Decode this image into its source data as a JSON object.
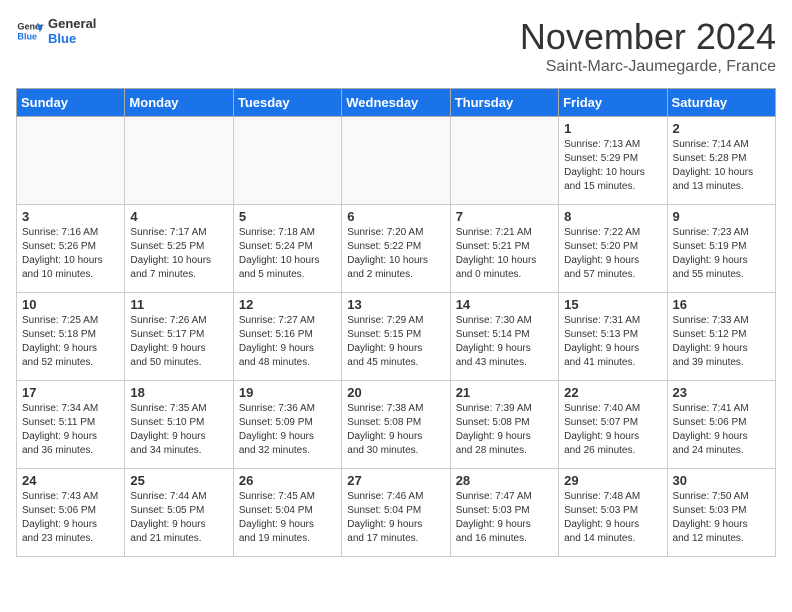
{
  "logo": {
    "line1": "General",
    "line2": "Blue"
  },
  "title": "November 2024",
  "location": "Saint-Marc-Jaumegarde, France",
  "days_of_week": [
    "Sunday",
    "Monday",
    "Tuesday",
    "Wednesday",
    "Thursday",
    "Friday",
    "Saturday"
  ],
  "weeks": [
    [
      {
        "day": "",
        "detail": ""
      },
      {
        "day": "",
        "detail": ""
      },
      {
        "day": "",
        "detail": ""
      },
      {
        "day": "",
        "detail": ""
      },
      {
        "day": "",
        "detail": ""
      },
      {
        "day": "1",
        "detail": "Sunrise: 7:13 AM\nSunset: 5:29 PM\nDaylight: 10 hours\nand 15 minutes."
      },
      {
        "day": "2",
        "detail": "Sunrise: 7:14 AM\nSunset: 5:28 PM\nDaylight: 10 hours\nand 13 minutes."
      }
    ],
    [
      {
        "day": "3",
        "detail": "Sunrise: 7:16 AM\nSunset: 5:26 PM\nDaylight: 10 hours\nand 10 minutes."
      },
      {
        "day": "4",
        "detail": "Sunrise: 7:17 AM\nSunset: 5:25 PM\nDaylight: 10 hours\nand 7 minutes."
      },
      {
        "day": "5",
        "detail": "Sunrise: 7:18 AM\nSunset: 5:24 PM\nDaylight: 10 hours\nand 5 minutes."
      },
      {
        "day": "6",
        "detail": "Sunrise: 7:20 AM\nSunset: 5:22 PM\nDaylight: 10 hours\nand 2 minutes."
      },
      {
        "day": "7",
        "detail": "Sunrise: 7:21 AM\nSunset: 5:21 PM\nDaylight: 10 hours\nand 0 minutes."
      },
      {
        "day": "8",
        "detail": "Sunrise: 7:22 AM\nSunset: 5:20 PM\nDaylight: 9 hours\nand 57 minutes."
      },
      {
        "day": "9",
        "detail": "Sunrise: 7:23 AM\nSunset: 5:19 PM\nDaylight: 9 hours\nand 55 minutes."
      }
    ],
    [
      {
        "day": "10",
        "detail": "Sunrise: 7:25 AM\nSunset: 5:18 PM\nDaylight: 9 hours\nand 52 minutes."
      },
      {
        "day": "11",
        "detail": "Sunrise: 7:26 AM\nSunset: 5:17 PM\nDaylight: 9 hours\nand 50 minutes."
      },
      {
        "day": "12",
        "detail": "Sunrise: 7:27 AM\nSunset: 5:16 PM\nDaylight: 9 hours\nand 48 minutes."
      },
      {
        "day": "13",
        "detail": "Sunrise: 7:29 AM\nSunset: 5:15 PM\nDaylight: 9 hours\nand 45 minutes."
      },
      {
        "day": "14",
        "detail": "Sunrise: 7:30 AM\nSunset: 5:14 PM\nDaylight: 9 hours\nand 43 minutes."
      },
      {
        "day": "15",
        "detail": "Sunrise: 7:31 AM\nSunset: 5:13 PM\nDaylight: 9 hours\nand 41 minutes."
      },
      {
        "day": "16",
        "detail": "Sunrise: 7:33 AM\nSunset: 5:12 PM\nDaylight: 9 hours\nand 39 minutes."
      }
    ],
    [
      {
        "day": "17",
        "detail": "Sunrise: 7:34 AM\nSunset: 5:11 PM\nDaylight: 9 hours\nand 36 minutes."
      },
      {
        "day": "18",
        "detail": "Sunrise: 7:35 AM\nSunset: 5:10 PM\nDaylight: 9 hours\nand 34 minutes."
      },
      {
        "day": "19",
        "detail": "Sunrise: 7:36 AM\nSunset: 5:09 PM\nDaylight: 9 hours\nand 32 minutes."
      },
      {
        "day": "20",
        "detail": "Sunrise: 7:38 AM\nSunset: 5:08 PM\nDaylight: 9 hours\nand 30 minutes."
      },
      {
        "day": "21",
        "detail": "Sunrise: 7:39 AM\nSunset: 5:08 PM\nDaylight: 9 hours\nand 28 minutes."
      },
      {
        "day": "22",
        "detail": "Sunrise: 7:40 AM\nSunset: 5:07 PM\nDaylight: 9 hours\nand 26 minutes."
      },
      {
        "day": "23",
        "detail": "Sunrise: 7:41 AM\nSunset: 5:06 PM\nDaylight: 9 hours\nand 24 minutes."
      }
    ],
    [
      {
        "day": "24",
        "detail": "Sunrise: 7:43 AM\nSunset: 5:06 PM\nDaylight: 9 hours\nand 23 minutes."
      },
      {
        "day": "25",
        "detail": "Sunrise: 7:44 AM\nSunset: 5:05 PM\nDaylight: 9 hours\nand 21 minutes."
      },
      {
        "day": "26",
        "detail": "Sunrise: 7:45 AM\nSunset: 5:04 PM\nDaylight: 9 hours\nand 19 minutes."
      },
      {
        "day": "27",
        "detail": "Sunrise: 7:46 AM\nSunset: 5:04 PM\nDaylight: 9 hours\nand 17 minutes."
      },
      {
        "day": "28",
        "detail": "Sunrise: 7:47 AM\nSunset: 5:03 PM\nDaylight: 9 hours\nand 16 minutes."
      },
      {
        "day": "29",
        "detail": "Sunrise: 7:48 AM\nSunset: 5:03 PM\nDaylight: 9 hours\nand 14 minutes."
      },
      {
        "day": "30",
        "detail": "Sunrise: 7:50 AM\nSunset: 5:03 PM\nDaylight: 9 hours\nand 12 minutes."
      }
    ]
  ]
}
